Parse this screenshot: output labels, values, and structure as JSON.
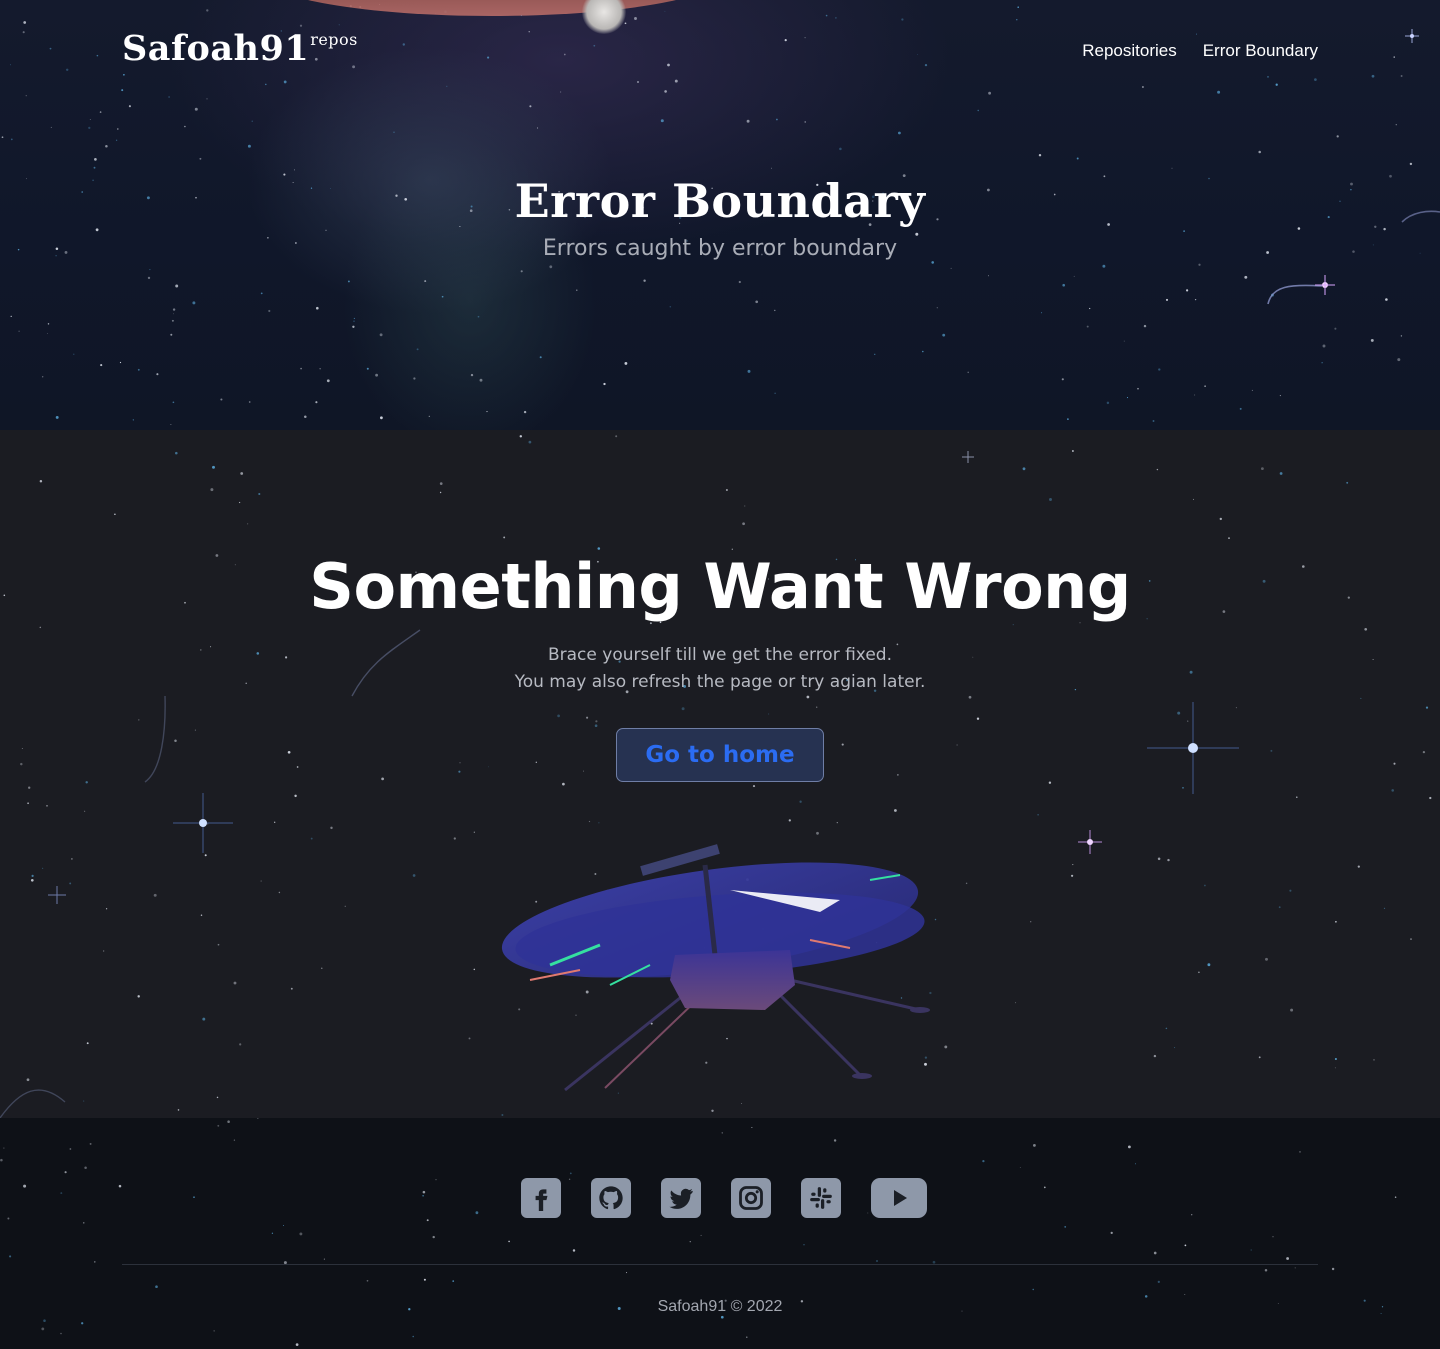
{
  "nav": {
    "logo": "Safoah91",
    "logo_sup": "repos",
    "links": [
      "Repositories",
      "Error Boundary"
    ]
  },
  "hero": {
    "title": "Error Boundary",
    "subtitle": "Errors caught by error boundary"
  },
  "error": {
    "title": "Something Want Wrong",
    "message_line1": "Brace yourself till we get the error fixed.",
    "message_line2": "You may also refresh the page or try agian later.",
    "button": "Go to home"
  },
  "footer": {
    "socials": [
      "facebook-icon",
      "github-icon",
      "twitter-icon",
      "instagram-icon",
      "slack-icon",
      "youtube-icon"
    ],
    "copyright": "Safoah91 © 2022"
  },
  "colors": {
    "hero_bg": "#111829",
    "main_bg": "#1b1c22",
    "footer_bg": "#0e1117",
    "button_text": "#2b6cf2",
    "button_bg": "#263251",
    "icon": "#8e98a9"
  }
}
